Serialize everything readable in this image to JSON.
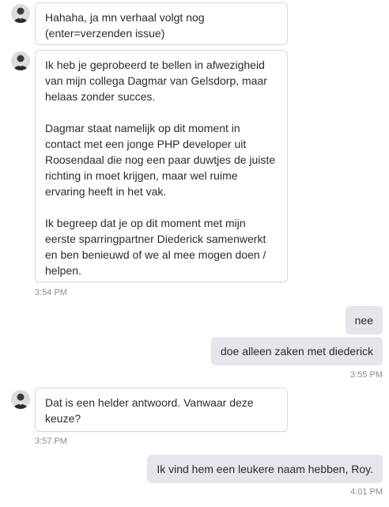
{
  "messages": {
    "m1": {
      "lines": "Hahaha, ja mn verhaal volgt nog\n(enter=verzenden issue)"
    },
    "m2": {
      "p1": "Ik heb je geprobeerd te bellen in afwezigheid\nvan mijn collega Dagmar van Gelsdorp, maar\nhelaas zonder succes.",
      "p2": "Dagmar staat namelijk op dit moment in\ncontact met een jonge PHP developer uit\nRoosendaal die nog een paar duwtjes de juiste\nrichting in moet krijgen, maar wel ruime\nervaring heeft in het vak.",
      "p3": "Ik begreep dat je op dit moment met mijn\neerste sparringpartner Diederick samenwerkt\nen ben benieuwd of we al mee mogen doen /\nhelpen.",
      "time": "3:54 PM"
    },
    "m3": {
      "text": "nee"
    },
    "m4": {
      "text": "doe alleen zaken met diederick",
      "time": "3:55 PM"
    },
    "m5": {
      "lines": "Dat is een helder antwoord. Vanwaar deze\nkeuze?",
      "time": "3:57 PM"
    },
    "m6": {
      "text": "Ik vind hem een leukere naam hebben, Roy.",
      "time": "4:01 PM"
    }
  },
  "colors": {
    "incoming_bg": "#ffffff",
    "incoming_border": "#d9d9d9",
    "outgoing_bg": "#e3e6ea",
    "timestamp": "#8a8a8a"
  },
  "icons": {
    "agent_avatar": "person-avatar-icon"
  }
}
